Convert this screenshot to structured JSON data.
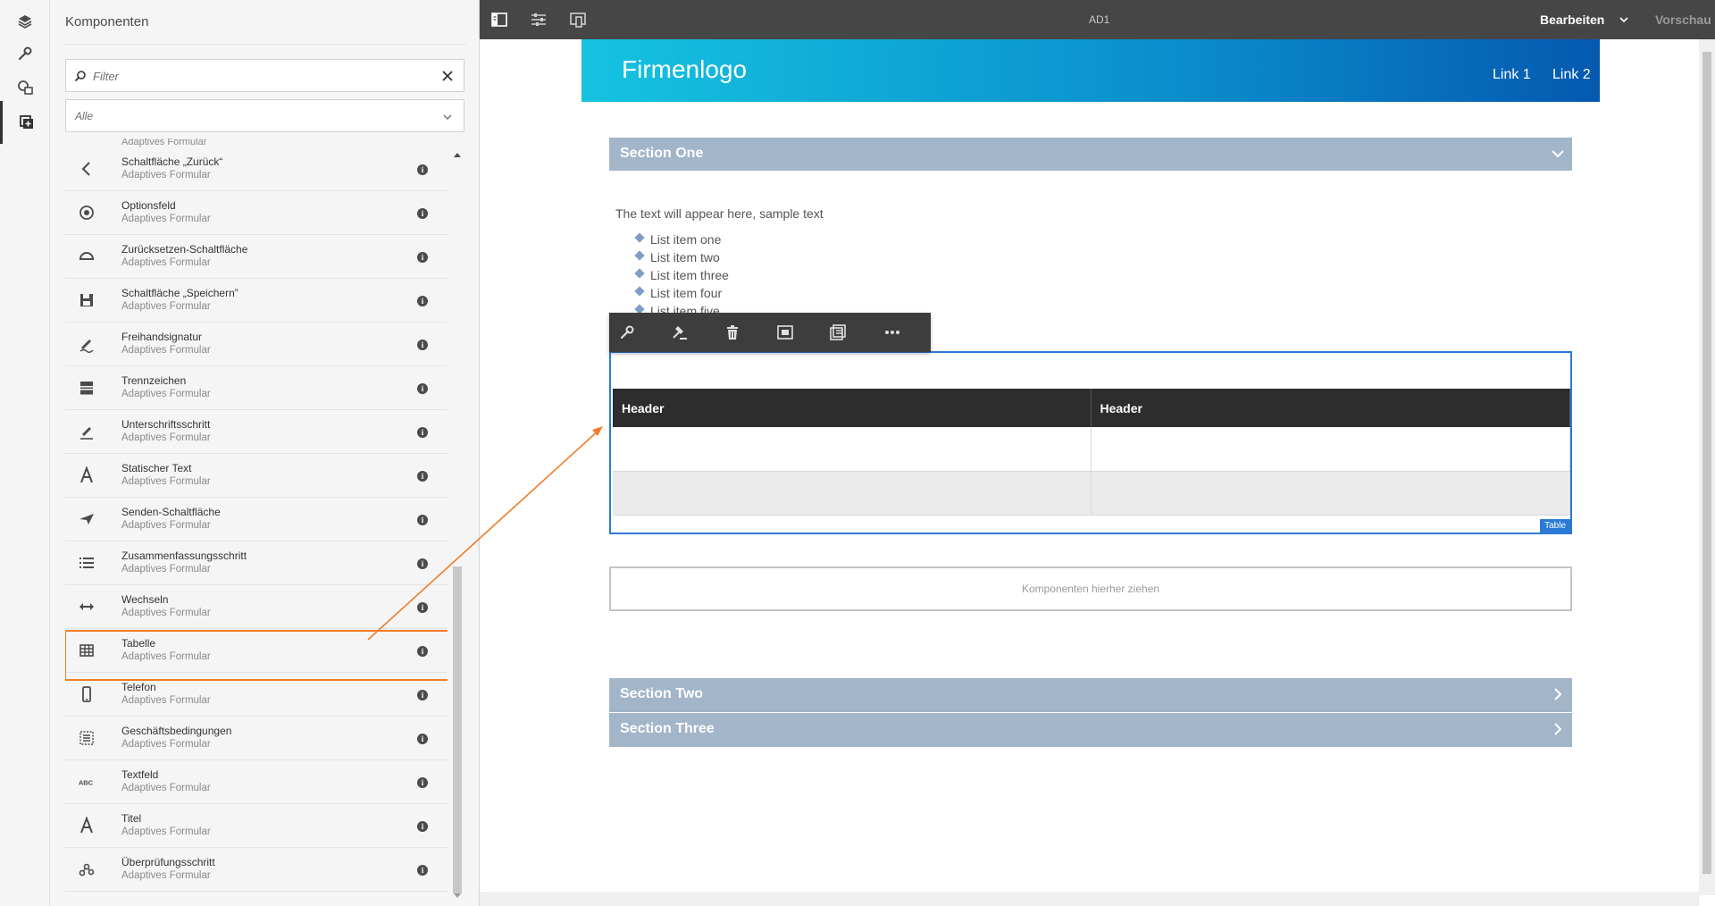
{
  "sidepanel": {
    "title": "Komponenten",
    "filter_placeholder": "Filter",
    "group_select": "Alle",
    "clipped_top_subtitle": "Adaptives Formular",
    "items": [
      {
        "name": "Schaltfläche „Zurück“",
        "sub": "Adaptives Formular",
        "icon": "chevron-left-icon"
      },
      {
        "name": "Optionsfeld",
        "sub": "Adaptives Formular",
        "icon": "radio-icon"
      },
      {
        "name": "Zurücksetzen-Schaltfläche",
        "sub": "Adaptives Formular",
        "icon": "reset-icon"
      },
      {
        "name": "Schaltfläche „Speichern”",
        "sub": "Adaptives Formular",
        "icon": "save-icon"
      },
      {
        "name": "Freihandsignatur",
        "sub": "Adaptives Formular",
        "icon": "signature-icon"
      },
      {
        "name": "Trennzeichen",
        "sub": "Adaptives Formular",
        "icon": "separator-icon"
      },
      {
        "name": "Unterschriftsschritt",
        "sub": "Adaptives Formular",
        "icon": "sign-step-icon"
      },
      {
        "name": "Statischer Text",
        "sub": "Adaptives Formular",
        "icon": "text-a-icon"
      },
      {
        "name": "Senden-Schaltfläche",
        "sub": "Adaptives Formular",
        "icon": "send-icon"
      },
      {
        "name": "Zusammenfassungsschritt",
        "sub": "Adaptives Formular",
        "icon": "list-icon"
      },
      {
        "name": "Wechseln",
        "sub": "Adaptives Formular",
        "icon": "switch-icon"
      },
      {
        "name": "Tabelle",
        "sub": "Adaptives Formular",
        "icon": "table-icon"
      },
      {
        "name": "Telefon",
        "sub": "Adaptives Formular",
        "icon": "phone-icon"
      },
      {
        "name": "Geschäftsbedingungen",
        "sub": "Adaptives Formular",
        "icon": "terms-icon"
      },
      {
        "name": "Textfeld",
        "sub": "Adaptives Formular",
        "icon": "abc-icon"
      },
      {
        "name": "Titel",
        "sub": "Adaptives Formular",
        "icon": "title-a-icon"
      },
      {
        "name": "Überprüfungsschritt",
        "sub": "Adaptives Formular",
        "icon": "verify-step-icon"
      }
    ]
  },
  "topbar": {
    "page_name": "AD1",
    "mode_edit": "Bearbeiten",
    "mode_preview": "Vorschau"
  },
  "page": {
    "logo": "Firmenlogo",
    "links": [
      "Link 1",
      "Link 2"
    ],
    "section_one": "Section One",
    "sample_text": "The text will appear here, sample text",
    "list_items": [
      "List item one",
      "List item two",
      "List item three",
      "List item four",
      "List item five"
    ],
    "table": {
      "headers": [
        "Header",
        "Header"
      ],
      "tag": "Table"
    },
    "dropzone": "Komponenten hierher ziehen",
    "section_two": "Section Two",
    "section_three": "Section Three"
  },
  "colors": {
    "highlight": "#f07d28",
    "selection": "#2b7bd6",
    "section_bar": "#a2b5c9",
    "topbar": "#464646"
  }
}
